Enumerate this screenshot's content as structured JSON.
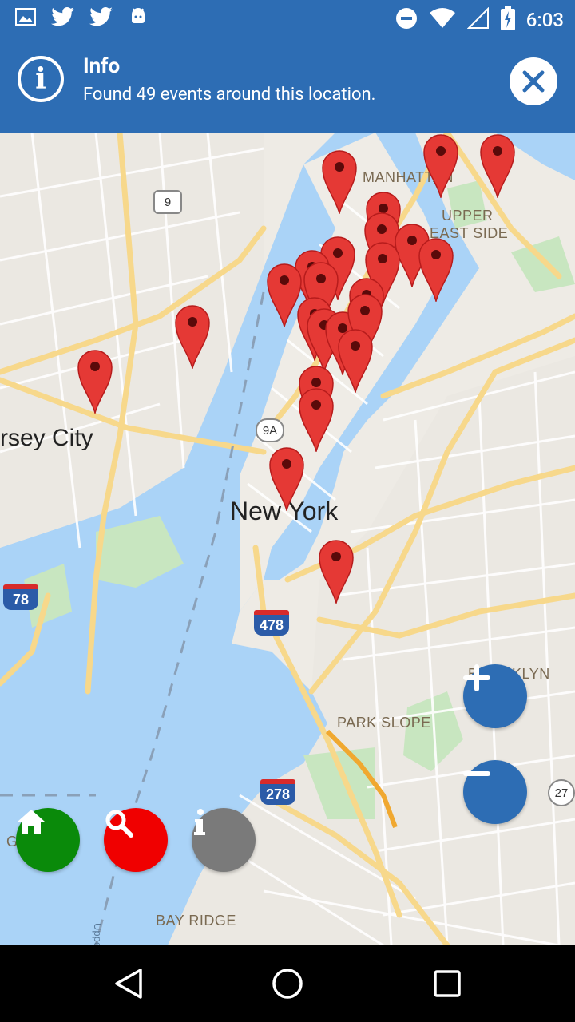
{
  "status_bar": {
    "time": "6:03",
    "left_icons": [
      "image-icon",
      "twitter-icon",
      "twitter-icon",
      "android-icon"
    ],
    "right_icons": [
      "do-not-disturb-icon",
      "wifi-icon",
      "signal-icon",
      "battery-icon"
    ]
  },
  "banner": {
    "title": "Info",
    "message": "Found 49 events around this location.",
    "icon": "info-icon",
    "close_icon": "close-icon"
  },
  "map": {
    "labels": {
      "city_main": "New York",
      "city_jersey": "rsey City",
      "manhattan": "MANHATTAN",
      "upper_east_1": "UPPER",
      "upper_east_2": "EAST SIDE",
      "brooklyn": "BROOKLYN",
      "park_slope": "PARK SLOPE",
      "bay_ridge": "BAY RIDGE",
      "g_label": "G",
      "upper_bay": "Upper B"
    },
    "shields": {
      "route_9": "9",
      "route_9a": "9A",
      "route_27": "27",
      "interstate_78": "78",
      "interstate_478": "478",
      "interstate_278": "278"
    },
    "marker_color": "#e53935",
    "marker_count_visible": 27
  },
  "controls": {
    "zoom_in_icon": "plus-icon",
    "zoom_out_icon": "minus-icon",
    "home_icon": "home-icon",
    "search_icon": "search-icon",
    "info_icon": "info-icon",
    "home_color": "#0a8a0a",
    "search_color": "#f00000",
    "info_color": "#7a7a7a",
    "zoom_color": "#2d6db4"
  },
  "nav_bar": {
    "icons": [
      "back-icon",
      "home-circle-icon",
      "recents-icon"
    ]
  },
  "colors": {
    "app_blue": "#2d6db4",
    "water": "#aad3f7",
    "park": "#c8e6c0",
    "road": "#f7d88b"
  }
}
